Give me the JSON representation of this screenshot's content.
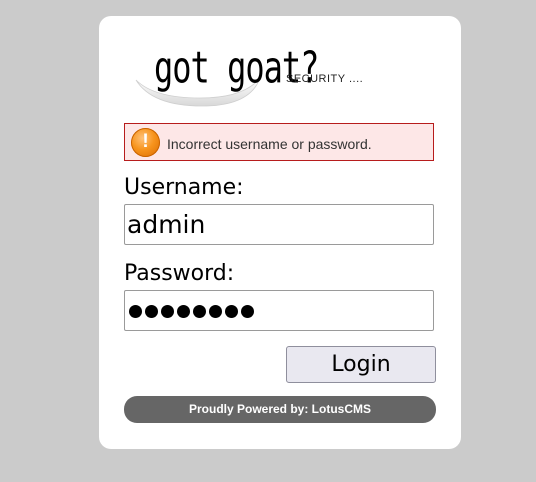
{
  "logo": {
    "text": "got goat?",
    "tagline": "SECURITY ...."
  },
  "alert": {
    "icon": "warning-icon",
    "icon_glyph": "!",
    "message": "Incorrect username or password.",
    "background_color": "#fde7e7",
    "border_color": "#b71c1c",
    "icon_color": "#f7941d"
  },
  "form": {
    "username_label": "Username:",
    "username_value": "admin",
    "password_label": "Password:",
    "password_masked_length": 8,
    "login_label": "Login"
  },
  "footer": {
    "text": "Proudly Powered by: LotusCMS"
  }
}
